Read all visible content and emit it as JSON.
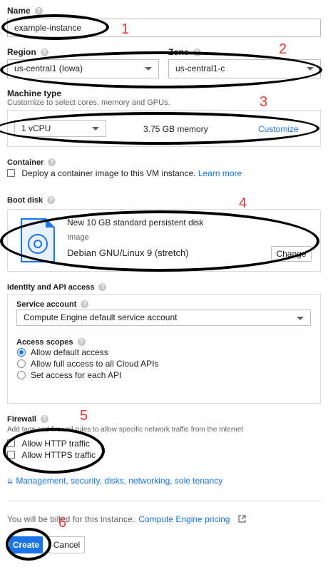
{
  "name": {
    "label": "Name",
    "value": "example-instance"
  },
  "region": {
    "label": "Region",
    "value": "us-central1 (Iowa)"
  },
  "zone": {
    "label": "Zone",
    "value": "us-central1-c"
  },
  "machine": {
    "label": "Machine type",
    "hint": "Customize to select cores, memory and GPUs.",
    "cpu": "1 vCPU",
    "memory": "3.75 GB memory",
    "customize": "Customize"
  },
  "container": {
    "label": "Container",
    "checkbox": "Deploy a container image to this VM instance.",
    "learn_more": "Learn more"
  },
  "boot_disk": {
    "label": "Boot disk",
    "title": "New 10 GB standard persistent disk",
    "image_label": "Image",
    "image": "Debian GNU/Linux 9 (stretch)",
    "change": "Change"
  },
  "identity": {
    "label": "Identity and API access",
    "service_account_label": "Service account",
    "service_account": "Compute Engine default service account",
    "scopes_label": "Access scopes",
    "scopes": [
      "Allow default access",
      "Allow full access to all Cloud APIs",
      "Set access for each API"
    ],
    "selected_scope": "Allow default access"
  },
  "firewall": {
    "label": "Firewall",
    "hint": "Add tags and firewall rules to allow specific network traffic from the Internet",
    "http": "Allow HTTP traffic",
    "https": "Allow HTTPS traffic"
  },
  "more_link": "Management, security, disks, networking, sole tenancy",
  "billing": {
    "text": "You will be billed for this instance.",
    "link": "Compute Engine pricing"
  },
  "actions": {
    "create": "Create",
    "cancel": "Cancel"
  },
  "annotations": [
    "1",
    "2",
    "3",
    "4",
    "5",
    "6"
  ],
  "colors": {
    "accent": "#1a73e8",
    "annotation": "#e53935",
    "create_button": "#1a73e8"
  }
}
